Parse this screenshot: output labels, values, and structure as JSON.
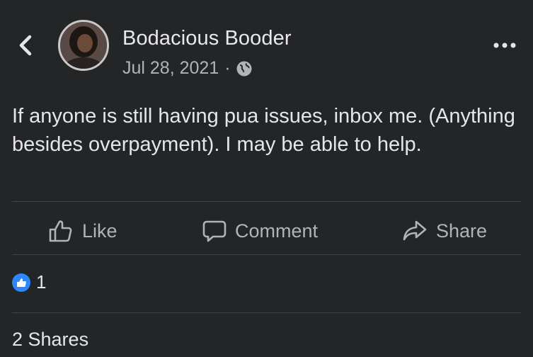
{
  "post": {
    "author": "Bodacious Booder",
    "date": "Jul 28, 2021",
    "separator": "·",
    "privacy_icon": "globe-icon",
    "text": "If anyone is still having pua issues, inbox me. (Anything besides overpayment). I may be able to help."
  },
  "actions": {
    "like_label": "Like",
    "comment_label": "Comment",
    "share_label": "Share"
  },
  "reactions": {
    "count": "1",
    "icon": "thumbs-up-icon",
    "color": "#2d88ff"
  },
  "shares_text": "2 Shares",
  "colors": {
    "background": "#242526",
    "text": "#e4e6eb",
    "secondary_text": "#b0b3b8",
    "divider": "#3e4042"
  }
}
